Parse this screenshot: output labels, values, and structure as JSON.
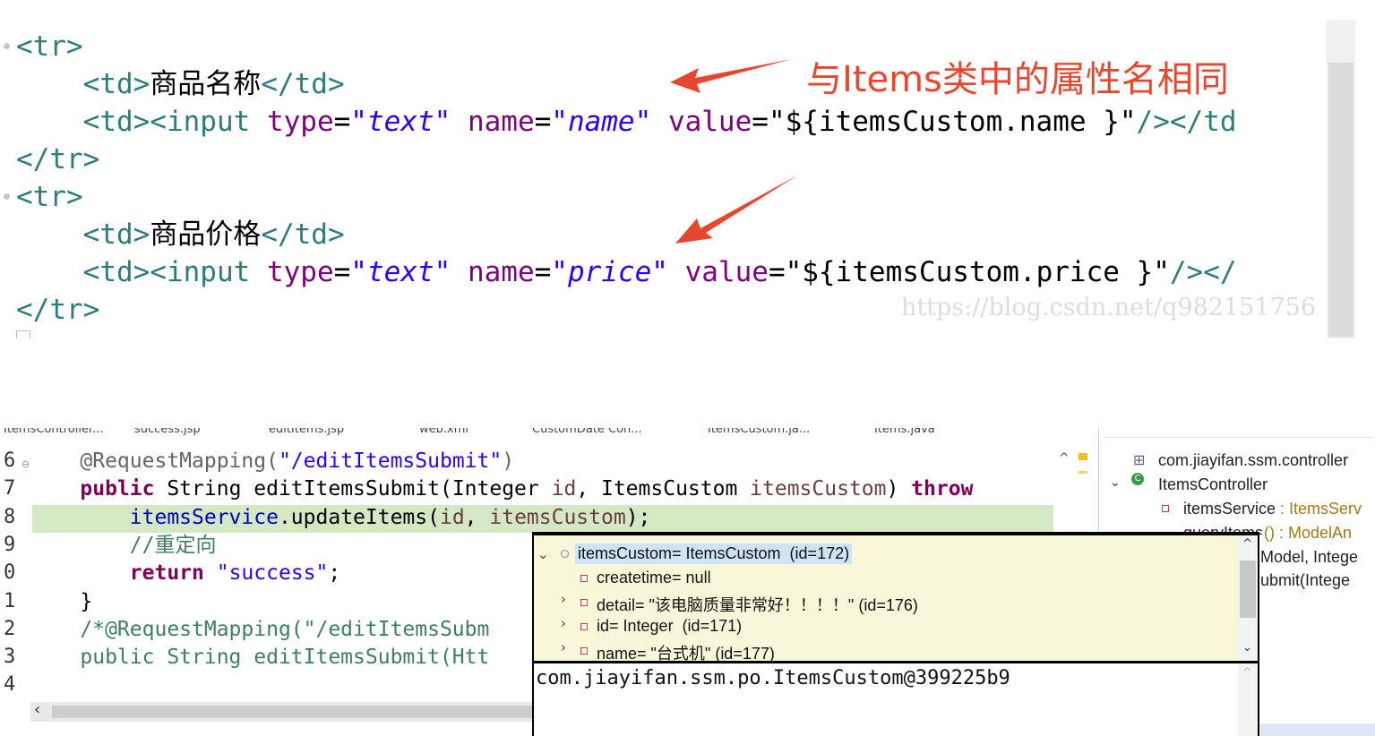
{
  "top_code": {
    "lines": [
      {
        "parts": [
          {
            "t": "<tr>",
            "c": "tag"
          }
        ]
      },
      {
        "parts": [
          {
            "t": "    ",
            "c": "plain"
          },
          {
            "t": "<td>",
            "c": "tag"
          },
          {
            "t": "商品名称",
            "c": "plain"
          },
          {
            "t": "</td>",
            "c": "tag"
          }
        ]
      },
      {
        "parts": [
          {
            "t": "    ",
            "c": "plain"
          },
          {
            "t": "<td><input ",
            "c": "tag"
          },
          {
            "t": "type",
            "c": "attr"
          },
          {
            "t": "=",
            "c": "plain"
          },
          {
            "t": "\"text\"",
            "c": "str"
          },
          {
            "t": " ",
            "c": "plain"
          },
          {
            "t": "name",
            "c": "attr"
          },
          {
            "t": "=",
            "c": "plain"
          },
          {
            "t": "\"name\"",
            "c": "str"
          },
          {
            "t": " ",
            "c": "plain"
          },
          {
            "t": "value",
            "c": "attr"
          },
          {
            "t": "=",
            "c": "plain"
          },
          {
            "t": "\"${itemsCustom.name }\"",
            "c": "plain"
          },
          {
            "t": "/></td",
            "c": "tag"
          }
        ]
      },
      {
        "parts": [
          {
            "t": "</tr>",
            "c": "tag"
          }
        ]
      },
      {
        "parts": [
          {
            "t": "<tr>",
            "c": "tag"
          }
        ]
      },
      {
        "parts": [
          {
            "t": "    ",
            "c": "plain"
          },
          {
            "t": "<td>",
            "c": "tag"
          },
          {
            "t": "商品价格",
            "c": "plain"
          },
          {
            "t": "</td>",
            "c": "tag"
          }
        ]
      },
      {
        "parts": [
          {
            "t": "    ",
            "c": "plain"
          },
          {
            "t": "<td><input ",
            "c": "tag"
          },
          {
            "t": "type",
            "c": "attr"
          },
          {
            "t": "=",
            "c": "plain"
          },
          {
            "t": "\"text\"",
            "c": "str"
          },
          {
            "t": " ",
            "c": "plain"
          },
          {
            "t": "name",
            "c": "attr"
          },
          {
            "t": "=",
            "c": "plain"
          },
          {
            "t": "\"price\"",
            "c": "str"
          },
          {
            "t": " ",
            "c": "plain"
          },
          {
            "t": "value",
            "c": "attr"
          },
          {
            "t": "=",
            "c": "plain"
          },
          {
            "t": "\"${itemsCustom.price }\"",
            "c": "plain"
          },
          {
            "t": "/></",
            "c": "tag"
          }
        ]
      },
      {
        "parts": [
          {
            "t": "</tr>",
            "c": "tag"
          }
        ]
      }
    ],
    "annotation": "与Items类中的属性名相同",
    "watermark": "https://blog.csdn.net/q982151756",
    "colors": {
      "tag": "#2e7d7d",
      "attribute": "#7f007f",
      "string": "#2a00ff",
      "annotation": "#e8472f"
    }
  },
  "editor_tabs": [
    "ItemsController...",
    "success.jsp",
    "editItems.jsp",
    "web.xml",
    "CustomDate Con...",
    "ItemsCustom.ja...",
    "Items.java"
  ],
  "java_editor": {
    "line_numbers": [
      "6",
      "7",
      "8",
      "9",
      "0",
      "1",
      "2",
      "3",
      "4"
    ],
    "lines": [
      {
        "parts": [
          {
            "t": "    ",
            "c": "jp"
          },
          {
            "t": "@RequestMapping(",
            "c": "ann"
          },
          {
            "t": "\"/editItemsSubmit\"",
            "c": "jstr"
          },
          {
            "t": ")",
            "c": "ann"
          }
        ]
      },
      {
        "parts": [
          {
            "t": "    ",
            "c": "jp"
          },
          {
            "t": "public",
            "c": "kw"
          },
          {
            "t": " String editItemsSubmit(Integer ",
            "c": "jp"
          },
          {
            "t": "id",
            "c": "loc"
          },
          {
            "t": ", ItemsCustom ",
            "c": "jp"
          },
          {
            "t": "itemsCustom",
            "c": "loc"
          },
          {
            "t": ") ",
            "c": "jp"
          },
          {
            "t": "throw",
            "c": "kw"
          }
        ]
      },
      {
        "parts": [
          {
            "t": "        ",
            "c": "jp"
          },
          {
            "t": "itemsService",
            "c": "fld"
          },
          {
            "t": ".updateItems(",
            "c": "jp"
          },
          {
            "t": "id",
            "c": "loc"
          },
          {
            "t": ", ",
            "c": "jp"
          },
          {
            "t": "itemsCustom",
            "c": "loc"
          },
          {
            "t": ");",
            "c": "jp"
          }
        ]
      },
      {
        "parts": [
          {
            "t": "        ",
            "c": "jp"
          },
          {
            "t": "//重定向",
            "c": "cmt"
          }
        ]
      },
      {
        "parts": [
          {
            "t": "        ",
            "c": "jp"
          },
          {
            "t": "return",
            "c": "kw"
          },
          {
            "t": " ",
            "c": "jp"
          },
          {
            "t": "\"success\"",
            "c": "jstr"
          },
          {
            "t": ";",
            "c": "jp"
          }
        ]
      },
      {
        "parts": [
          {
            "t": "    }",
            "c": "jp"
          }
        ]
      },
      {
        "parts": [
          {
            "t": "    ",
            "c": "jp"
          },
          {
            "t": "/*@RequestMapping(\"/editItemsSubm",
            "c": "cmt"
          }
        ]
      },
      {
        "parts": [
          {
            "t": "    ",
            "c": "jp"
          },
          {
            "t": "public String editItemsSubmit(Htt",
            "c": "cmt"
          }
        ]
      },
      {
        "parts": [
          {
            "t": "",
            "c": "jp"
          }
        ]
      }
    ]
  },
  "outline": {
    "package": "com.jiayifan.ssm.controller",
    "class": "ItemsController",
    "field_name": "itemsService",
    "field_type": " : ItemsServ",
    "method1_name": "queryItems",
    "method1_suffix": "() : ModelAn",
    "method2_visible": "Model, Intege",
    "method3_visible": "ubmit(Intege"
  },
  "debug_popup": {
    "root": "itemsCustom= ItemsCustom  (id=172)",
    "children": [
      {
        "label": "createtime= null",
        "expandable": false
      },
      {
        "label": "detail= \"该电脑质量非常好！！！！\" (id=176)",
        "expandable": true
      },
      {
        "label": "id= Integer  (id=171)",
        "expandable": true
      },
      {
        "label": "name= \"台式机\" (id=177)",
        "expandable": true
      }
    ],
    "detail_text": "com.jiayifan.ssm.po.ItemsCustom@399225b9"
  }
}
